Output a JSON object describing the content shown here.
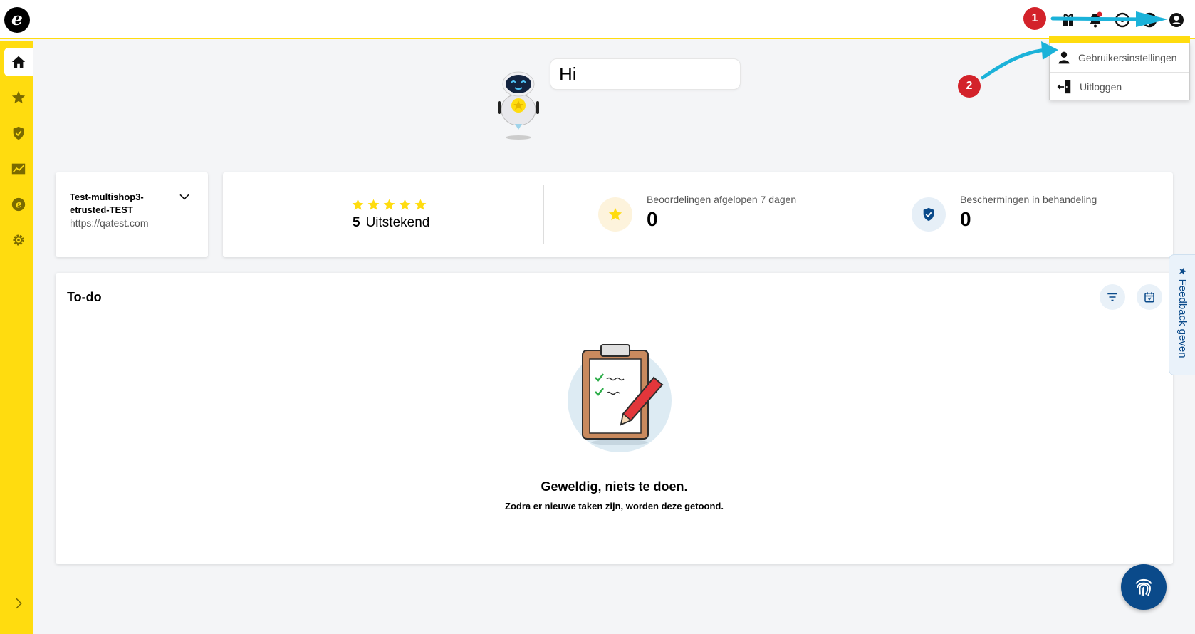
{
  "app": {
    "logo_letter": "e",
    "brand_color": "#ffdc0f",
    "accent_color": "#0a4a8a"
  },
  "topbar": {
    "icons": [
      "gift-icon",
      "bell-icon",
      "help-icon",
      "halfmoon-icon",
      "account-icon"
    ],
    "notification_dot_color": "#d3222a"
  },
  "sidebar": {
    "items": [
      {
        "icon": "home-icon",
        "active": true
      },
      {
        "icon": "star-icon",
        "active": false
      },
      {
        "icon": "shield-check-icon",
        "active": false
      },
      {
        "icon": "chart-icon",
        "active": false
      },
      {
        "icon": "etrusted-icon",
        "active": false
      },
      {
        "icon": "gear-icon",
        "active": false
      }
    ],
    "expand_icon": "chevron-right-icon"
  },
  "greeting": {
    "text": "Hi"
  },
  "shop": {
    "name": "Test-multishop3-etrusted-TEST",
    "url": "https://qatest.com"
  },
  "stats": {
    "rating": {
      "stars": 5,
      "score": "5",
      "label": "Uitstekend"
    },
    "reviews": {
      "label": "Beoordelingen afgelopen 7 dagen",
      "value": "0"
    },
    "protections": {
      "label": "Beschermingen in behandeling",
      "value": "0"
    }
  },
  "todo": {
    "title": "To-do",
    "empty_title": "Geweldig, niets te doen.",
    "empty_subtitle": "Zodra er nieuwe taken zijn, worden deze getoond."
  },
  "feedback": {
    "label": "Feedback geven"
  },
  "dropdown": {
    "items": [
      {
        "label": "Gebruikersinstellingen",
        "icon": "user-icon"
      },
      {
        "label": "Uitloggen",
        "icon": "logout-icon"
      }
    ]
  },
  "annotations": {
    "badge_1": "1",
    "badge_2": "2",
    "arrow_color": "#1bb2d9"
  }
}
